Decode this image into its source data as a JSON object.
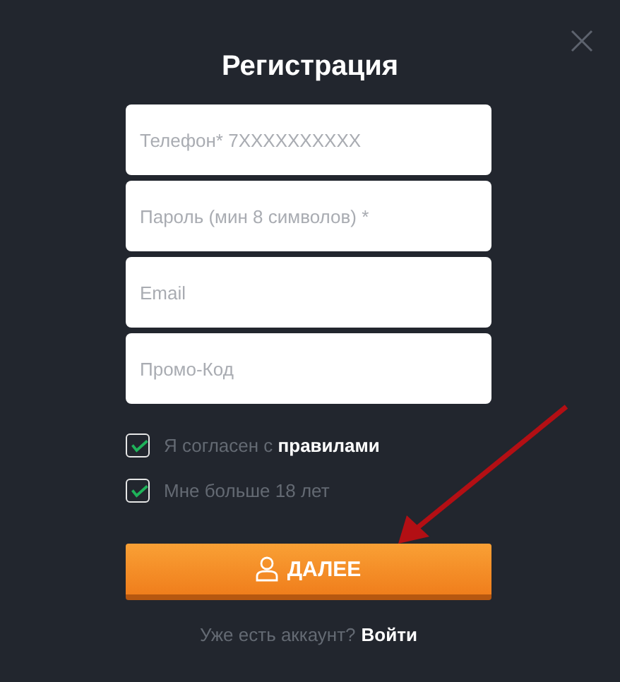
{
  "title": "Регистрация",
  "fields": [
    {
      "placeholder": "Телефон* 7XXXXXXXXXX"
    },
    {
      "placeholder": "Пароль (мин 8 символов) *"
    },
    {
      "placeholder": "Email"
    },
    {
      "placeholder": "Промо-Код"
    }
  ],
  "checkboxes": [
    {
      "label": "Я согласен с ",
      "link": "правилами",
      "checked": true
    },
    {
      "label": "Мне больше 18 лет",
      "checked": true
    }
  ],
  "submit": "ДАЛЕЕ",
  "footer": {
    "text": "Уже есть аккаунт?",
    "link": "Войти"
  }
}
